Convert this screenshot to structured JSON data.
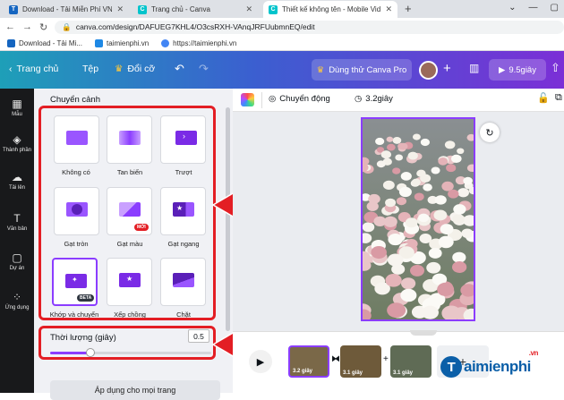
{
  "browser": {
    "tabs": [
      {
        "title": "Download - Tải Miễn Phí VN - Ph",
        "favicon": "T",
        "color": "#1565c0"
      },
      {
        "title": "Trang chủ - Canva",
        "favicon": "C",
        "color": "#00c4cc"
      },
      {
        "title": "Thiết kế không tên - Mobile Video",
        "favicon": "C",
        "color": "#00c4cc"
      }
    ],
    "new_tab": "+",
    "url": "canva.com/design/DAFUEG7KHL4/O3csRXH-VAnqJRFUubmnEQ/edit",
    "bookmarks": [
      {
        "label": "Download - Tải Mi...",
        "color": "#1565c0"
      },
      {
        "label": "taimienphi.vn",
        "color": "#1e88e5"
      },
      {
        "label": "https://taimienphi.vn",
        "color": "#4285f4"
      }
    ]
  },
  "topbar": {
    "home": "Trang chủ",
    "file": "Tệp",
    "resize": "Đổi cỡ",
    "try_pro": "Dùng thử Canva Pro",
    "add": "+",
    "share": "9.5giây"
  },
  "rail": [
    {
      "label": "Mẫu",
      "icon": "template-icon",
      "glyph": "▦"
    },
    {
      "label": "Thành phần",
      "icon": "elements-icon",
      "glyph": "◈"
    },
    {
      "label": "Tải lên",
      "icon": "upload-icon",
      "glyph": "☁"
    },
    {
      "label": "Văn bản",
      "icon": "text-icon",
      "glyph": "T"
    },
    {
      "label": "Dự án",
      "icon": "projects-icon",
      "glyph": "▢"
    },
    {
      "label": "Ứng dụng",
      "icon": "apps-icon",
      "glyph": "⁘"
    }
  ],
  "panel": {
    "title": "Chuyển cảnh",
    "transitions": [
      {
        "label": "Không có",
        "icon": "none-transition-icon"
      },
      {
        "label": "Tan biến",
        "icon": "dissolve-transition-icon"
      },
      {
        "label": "Trượt",
        "icon": "slide-transition-icon"
      },
      {
        "label": "Gạt tròn",
        "icon": "circle-wipe-transition-icon"
      },
      {
        "label": "Gạt màu",
        "icon": "color-wipe-transition-icon",
        "badge": "MỚI"
      },
      {
        "label": "Gạt ngang",
        "icon": "line-wipe-transition-icon"
      },
      {
        "label": "Khớp và chuyển",
        "icon": "match-and-move-transition-icon",
        "badge": "BETA",
        "selected": true
      },
      {
        "label": "Xếp chồng",
        "icon": "stack-transition-icon"
      },
      {
        "label": "Chặt",
        "icon": "chop-transition-icon"
      }
    ],
    "duration_label": "Thời lượng (giây)",
    "duration_value": "0.5",
    "duration_fraction": 0.25,
    "apply_all": "Áp dụng cho mọi trang"
  },
  "callouts": [
    "1",
    "2"
  ],
  "editor": {
    "animate": "Chuyển động",
    "duration": "3.2giây"
  },
  "timeline": {
    "clips": [
      "3.2 giây",
      "3.1 giây",
      "3.1 giây"
    ],
    "add": "+"
  },
  "logo": {
    "t": "T",
    "rest": "aimienphi",
    "suffix": ".vn"
  },
  "colors": {
    "accent": "#8b3dff",
    "callout": "#e31e24"
  }
}
